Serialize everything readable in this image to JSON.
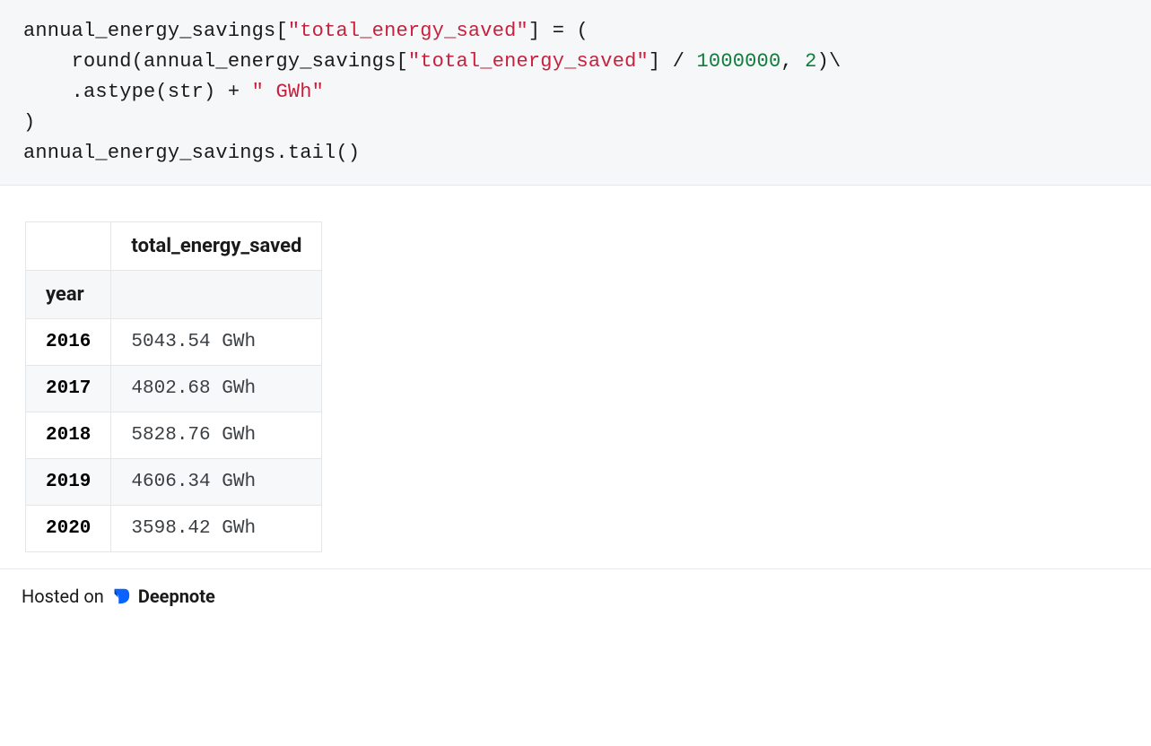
{
  "code": {
    "lines": [
      {
        "segments": [
          {
            "t": "annual_energy_savings[",
            "c": "plain"
          },
          {
            "t": "\"total_energy_saved\"",
            "c": "str"
          },
          {
            "t": "] = (",
            "c": "plain"
          }
        ]
      },
      {
        "segments": [
          {
            "t": "    round(annual_energy_savings[",
            "c": "plain"
          },
          {
            "t": "\"total_energy_saved\"",
            "c": "str"
          },
          {
            "t": "] / ",
            "c": "plain"
          },
          {
            "t": "1000000",
            "c": "num"
          },
          {
            "t": ", ",
            "c": "plain"
          },
          {
            "t": "2",
            "c": "num"
          },
          {
            "t": ")\\",
            "c": "plain"
          }
        ]
      },
      {
        "segments": [
          {
            "t": "    .astype(str) + ",
            "c": "plain"
          },
          {
            "t": "\" GWh\"",
            "c": "str"
          }
        ]
      },
      {
        "segments": [
          {
            "t": ")",
            "c": "plain"
          }
        ]
      },
      {
        "segments": [
          {
            "t": "annual_energy_savings.tail()",
            "c": "plain"
          }
        ]
      }
    ]
  },
  "table": {
    "column_header": "total_energy_saved",
    "index_name": "year",
    "rows": [
      {
        "year": "2016",
        "value": "5043.54 GWh"
      },
      {
        "year": "2017",
        "value": "4802.68 GWh"
      },
      {
        "year": "2018",
        "value": "5828.76 GWh"
      },
      {
        "year": "2019",
        "value": "4606.34 GWh"
      },
      {
        "year": "2020",
        "value": "3598.42 GWh"
      }
    ]
  },
  "footer": {
    "hosted_on": "Hosted on",
    "brand": "Deepnote"
  }
}
